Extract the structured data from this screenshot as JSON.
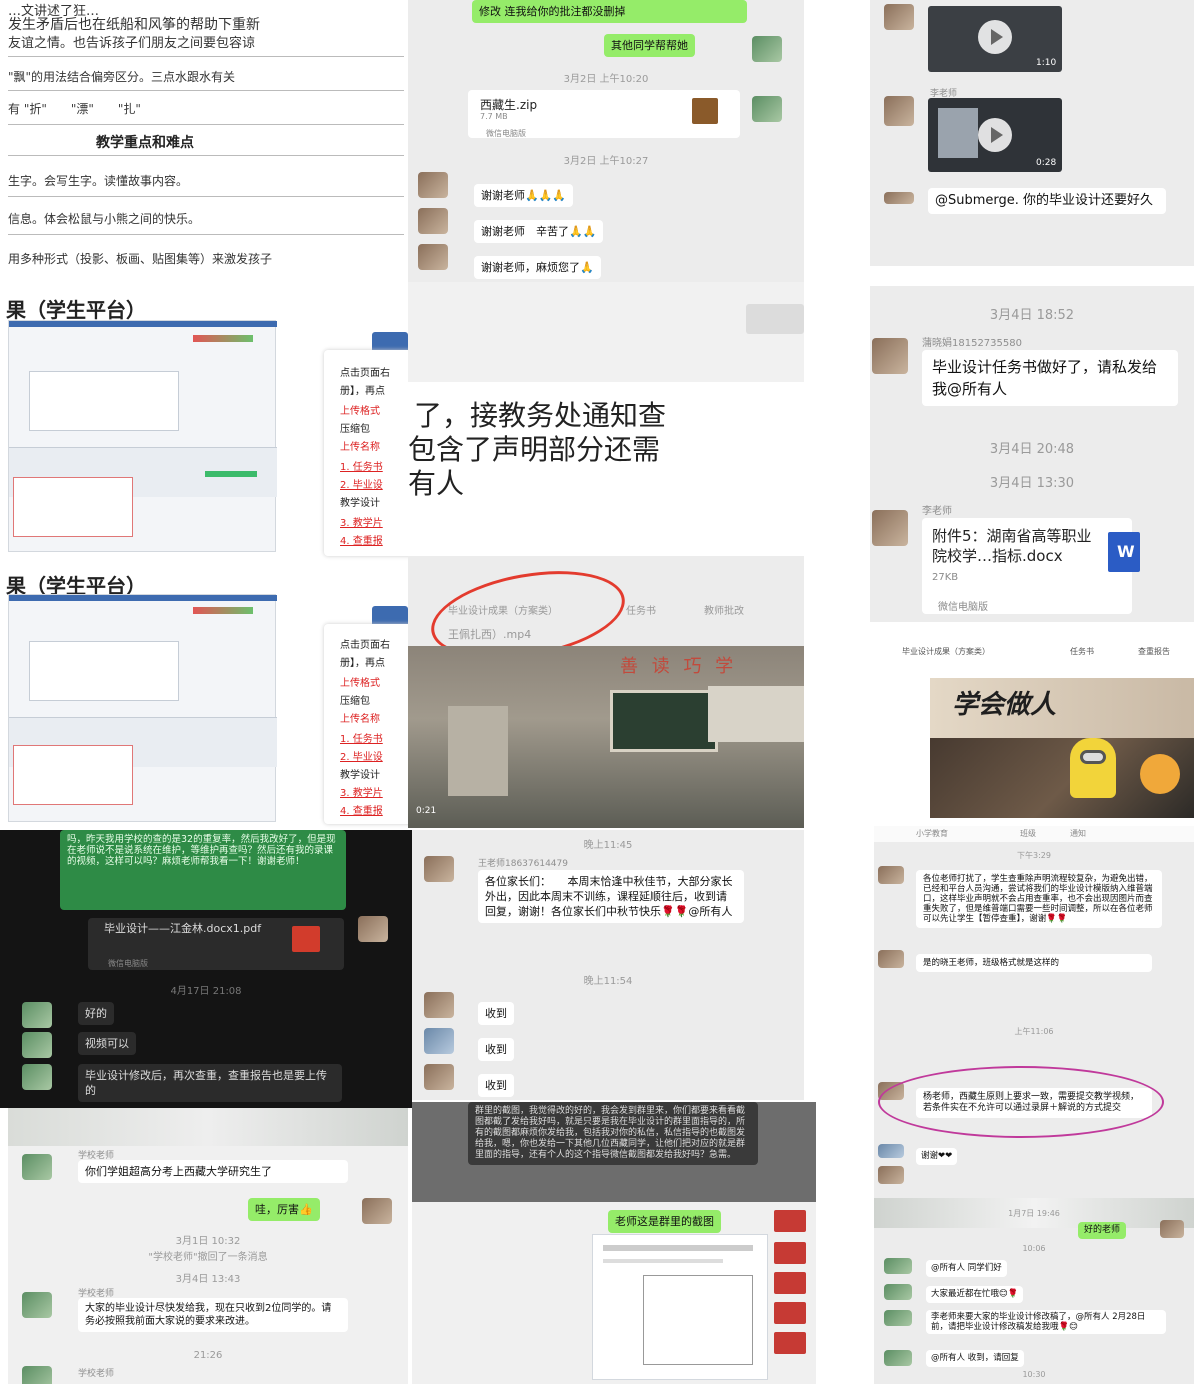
{
  "doc": {
    "line1": "…文讲述了狂…",
    "line2": "发生矛盾后也在纸船和风筝的帮助下重新",
    "line3": "友谊之情。也告诉孩子们朋友之间要包容谅",
    "line4": "\"飘\"的用法结合偏旁区分。三点水跟水有关",
    "line5": "有 \"折\"　　\"漂\"　　\"扎\"",
    "heading": "教学重点和难点",
    "line6": "生字。会写生字。读懂故事内容。",
    "line7": "信息。体会松鼠与小熊之间的快乐。",
    "line8": "用多种形式（投影、板画、贴图集等）来激发孩子",
    "result_title": "果（学生平台）",
    "side_l1": "点击页面右",
    "side_l2": "册】，再点",
    "side_l3": "上传格式",
    "side_l4": "压缩包",
    "side_l5": "上传名称",
    "side_l6": "1. 任务书",
    "side_l7": "2. 毕业设",
    "side_l8": "教学设计",
    "side_l9": "3. 教学片",
    "side_l10": "4. 查重报"
  },
  "chat_top_mid": {
    "top_bubble": "修改 连我给你的批注都没删掉",
    "my_msg": "其他同学帮帮她",
    "time1": "3月2日 上午10:20",
    "file_name": "西藏生.zip",
    "file_size": "7.7 MB",
    "file_source": "微信电脑版",
    "time2": "3月2日 上午10:27",
    "thanks1": "谢谢老师🙏🙏🙏",
    "thanks2": "谢谢老师　辛苦了🙏🙏",
    "thanks3": "谢谢老师，麻烦您了🙏"
  },
  "zoom_text": {
    "line1": "了，接教务处通知查",
    "line2": "包含了声明部分还需",
    "line3": "有人"
  },
  "video_mid": {
    "tab1": "毕业设计成果（方案类）",
    "tab2": "任务书",
    "tab3": "教师批改",
    "file": "王佩扎西）.mp4",
    "poster": "善 读 巧 学",
    "duration": "0:21"
  },
  "right_top": {
    "name": "李老师",
    "msg": "@Submerge. 你的毕业设计还要好久",
    "duration1": "1:10",
    "duration2": "0:28"
  },
  "right_chat": {
    "time1": "3月4日 18:52",
    "sender": "蒲晓娟18152735580",
    "msg": "毕业设计任务书做好了，请私发给我@所有人",
    "time2": "3月4日 20:48",
    "time3": "3月4日 13:30",
    "sender2": "李老师",
    "file_name": "附件5：湖南省高等职业院校学…指标.docx",
    "file_size": "27KB",
    "file_source": "微信电脑版"
  },
  "right_video": {
    "tab1": "毕业设计成果（方案类）",
    "tab2": "任务书",
    "tab3": "查重报告",
    "poster_text": "学会做人"
  },
  "dark_chat": {
    "green_text": "吗，昨天我用学校的查的是32的重复率，然后我改好了，但是现在老师说不是说系统在维护，等维护再查吗？然后还有我的录课的视频，这样可以吗？麻烦老师帮我看一下！谢谢老师！",
    "file_name": "毕业设计——江金林.docx1.pdf",
    "file_source": "微信电脑版",
    "time": "4月17日 21:08",
    "r1": "好的",
    "r2": "视频可以",
    "r3": "毕业设计修改后，再次查重，查重报告也是要上传的"
  },
  "mid_chat": {
    "time1": "晚上11:45",
    "sender": "王老师18637614479",
    "msg": "各位家长们：　　本周末恰逢中秋佳节，大部分家长外出，因此本周末不训练，课程延顺往后，收到请回复，谢谢！各位家长们中秋节快乐🌹🌹@所有人",
    "time2": "晚上11:54",
    "r1": "收到",
    "r2": "收到",
    "r3": "收到"
  },
  "bottom_left": {
    "sender": "学校老师",
    "msg": "你们学姐超高分考上西藏大学研究生了",
    "my_msg": "哇，厉害👍",
    "time1": "3月1日 10:32",
    "recall": "\"学校老师\"撤回了一条消息",
    "time2": "3月4日 13:43",
    "msg2": "大家的毕业设计尽快发给我，现在只收到2位同学的。请务必按照我前面大家说的要求来改进。",
    "time3": "21:26"
  },
  "bottom_mid": {
    "dark_text": "群里的截图，我觉得改的好的，我会发到群里来，你们都要来看看截图都截了发给我好吗，就是只要是我在毕业设计的群里面指导的，所有的截图都麻烦你发给我，包括我对你的私信，私信指导的也截图发给我，嗯，你也发给一下其他几位西藏同学，让他们把对应的就是群里面的指导，还有个人的这个指导微信截图都发给我好吗？急需。",
    "my_msg": "老师这是群里的截图"
  },
  "right_group": {
    "tab1": "小学教育",
    "tab2": "班级",
    "tab3": "通知",
    "time": "下午3:29",
    "msg1": "各位老师打扰了，学生查重除声明流程较复杂，为避免出错，已经和平台人员沟通，尝试将我们的毕业设计模版纳入维普端口，这样毕业声明就不会占用查重率，也不会出现因图片而查重失败了，但是维普端口需要一些时间调整，所以在各位老师可以先让学生【暂停查重】，谢谢🌹🌹",
    "msg2": "是的晓王老师，班级格式就是这样的",
    "time2": "上午11:06",
    "msg3": "杨老师，西藏生原则上要求一致，需要提交教学视频，若条件实在不允许可以通过录屏＋解说的方式提交",
    "reply": "谢谢❤❤"
  },
  "right_bottom": {
    "top_time": "1月7日 19:46",
    "my_msg": "好的老师",
    "time1": "10:06",
    "l1": "@所有人 同学们好",
    "l2": "大家最近都在忙哦😊🌹",
    "l3": "李老师来要大家的毕业设计修改稿了，@所有人 2月28日前，请把毕业设计修改稿发给我哦🌹😊",
    "l4": "@所有人 收到，请回复",
    "time2": "10:30"
  }
}
